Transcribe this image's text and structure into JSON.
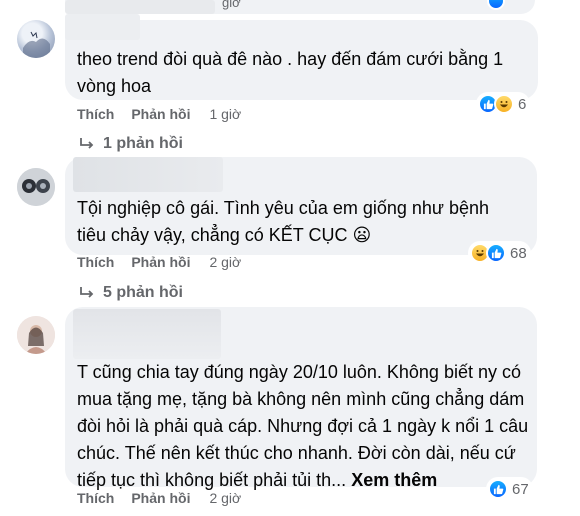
{
  "top": {
    "time_partial": "giờ"
  },
  "comments": [
    {
      "text": "theo trend đòi quà đê nào . hay đến đám cưới bằng 1 vòng hoa",
      "like_label": "Thích",
      "reply_label": "Phản hồi",
      "time": "1 giờ",
      "reaction_count": "6",
      "replies_label": "1 phản hồi"
    },
    {
      "text": "Tội nghiệp cô gái. Tình yêu của em giống như bệnh tiêu chảy vậy, chẳng có KẾT CỤC",
      "emoji": "😦",
      "like_label": "Thích",
      "reply_label": "Phản hồi",
      "time": "2 giờ",
      "reaction_count": "68",
      "replies_label": "5 phản hồi"
    },
    {
      "text": "T cũng chia tay đúng ngày 20/10 luôn. Không biết ny có mua tặng mẹ, tặng bà không nên mình cũng chẳng dám đòi hỏi là phải quà cáp. Nhưng đợi cả 1 ngày k nổi 1 câu chúc. Thế nên kết thúc cho nhanh. Đời còn dài, nếu cứ tiếp tục thì không biết phải tủi th...",
      "see_more": "Xem thêm",
      "like_label": "Thích",
      "reply_label": "Phản hồi",
      "time": "2 giờ",
      "reaction_count": "67"
    }
  ],
  "colors": {
    "bubble": "#f0f2f5",
    "meta": "#65676b",
    "like": "#0866ff",
    "haha": "#f7b125"
  },
  "icons": [
    "like-icon",
    "haha-icon",
    "reply-arrow-icon",
    "frowning-emoji"
  ]
}
